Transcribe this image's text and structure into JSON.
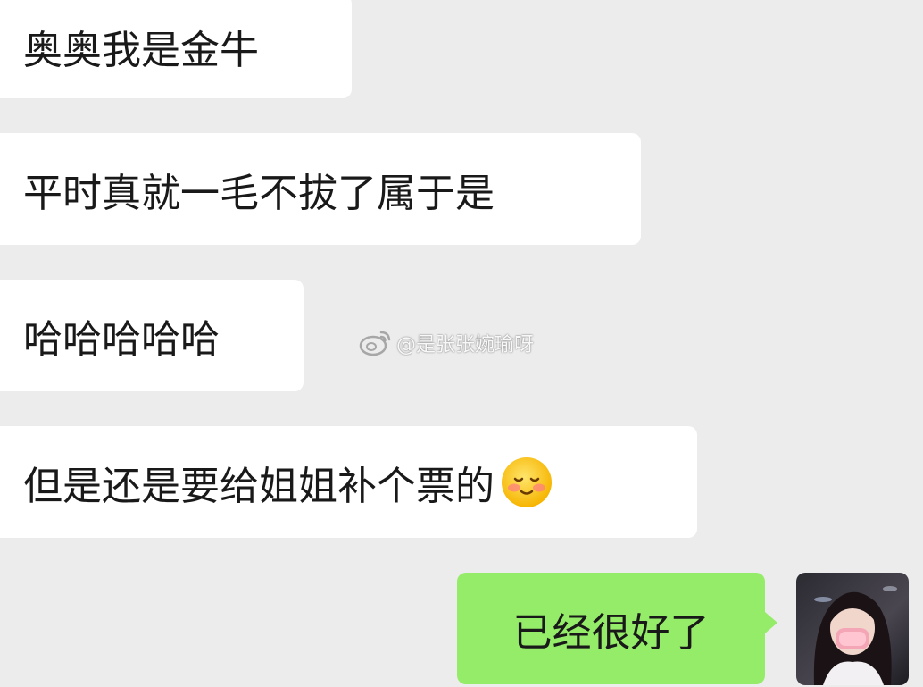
{
  "messages": [
    {
      "text": "奥奥我是金牛",
      "side": "incoming"
    },
    {
      "text": "平时真就一毛不拔了属于是",
      "side": "incoming"
    },
    {
      "text": "哈哈哈哈哈",
      "side": "incoming"
    },
    {
      "text": "但是还是要给姐姐补个票的",
      "side": "incoming",
      "emoji": "smiling-face-with-blush-emoji"
    },
    {
      "text": "已经很好了",
      "side": "outgoing"
    }
  ],
  "watermark": {
    "text": "@是张张婉瑜呀",
    "icon": "weibo-icon"
  },
  "colors": {
    "background": "#ececec",
    "incoming_bubble": "#ffffff",
    "outgoing_bubble": "#95ec69"
  }
}
